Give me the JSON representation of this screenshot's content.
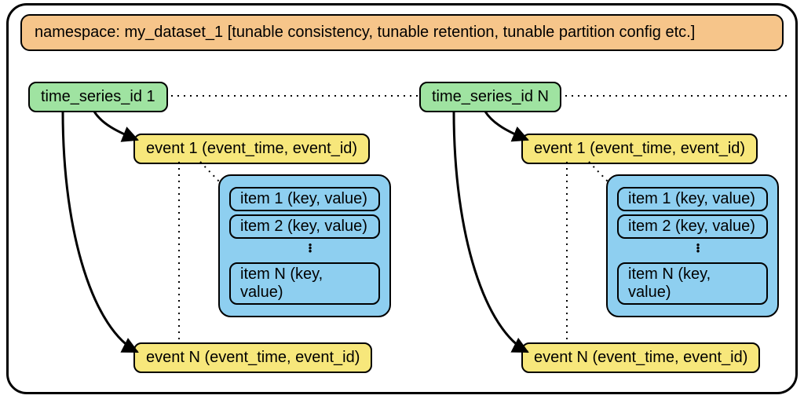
{
  "namespace": {
    "label": "namespace: my_dataset_1 [tunable consistency, tunable retention, tunable partition config etc.]"
  },
  "left": {
    "ts_label": "time_series_id 1",
    "event_first": "event 1 (event_time, event_id)",
    "event_last": "event N (event_time, event_id)",
    "items": {
      "first": "item 1 (key, value)",
      "second": "item 2 (key, value)",
      "last": "item N (key, value)"
    }
  },
  "right": {
    "ts_label": "time_series_id N",
    "event_first": "event 1 (event_time, event_id)",
    "event_last": "event N (event_time, event_id)",
    "items": {
      "first": "item 1 (key, value)",
      "second": "item 2 (key, value)",
      "last": "item N (key, value)"
    }
  },
  "colors": {
    "namespace": "#f6c58a",
    "time_series": "#9fe3a1",
    "event": "#f7e77b",
    "items": "#8ecff0"
  }
}
